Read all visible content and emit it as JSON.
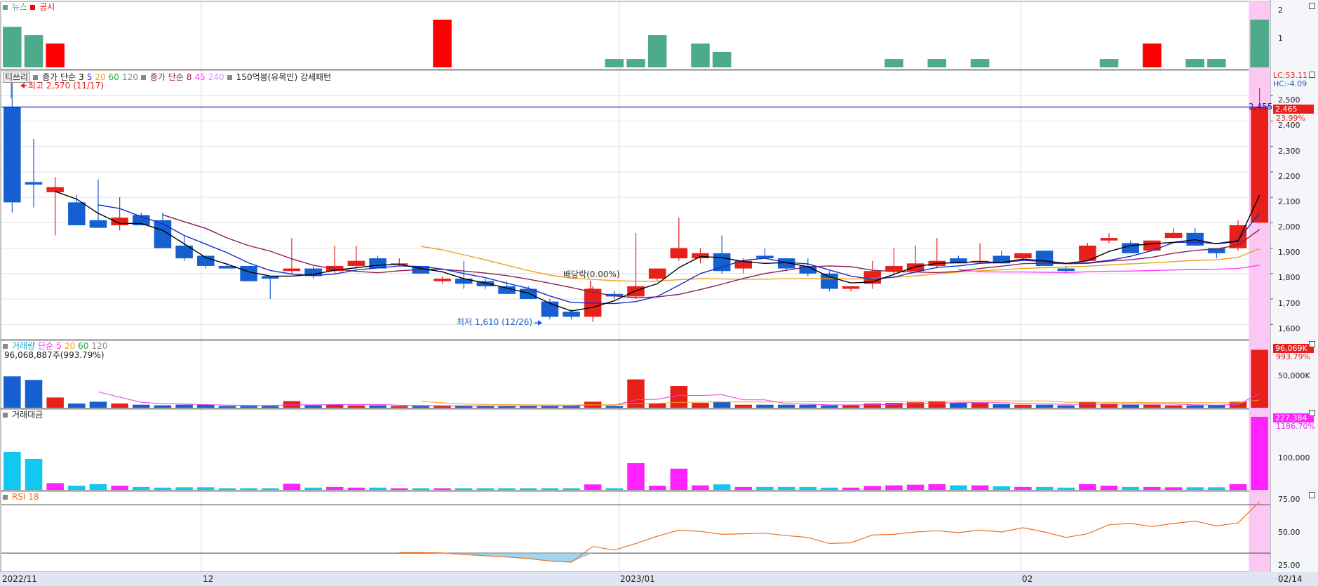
{
  "colors": {
    "up": "#e8201a",
    "down": "#1560d0",
    "news": "#4daa8a",
    "disclosure": "#ff0000",
    "amount": "#ff22ff",
    "amount_old": "#10c8f0",
    "highlight": "#fbc8f4",
    "ma3": "#000000",
    "ma5": "#1a2ccc",
    "ma8": "#8a1e50",
    "ma20": "#f0a020",
    "ma45": "#ff40ff",
    "rsi": "#f07020",
    "rsi_fill": "#9fd8ee",
    "hline": "#2020c0"
  },
  "news_panel": {
    "title_news": "뉴스",
    "title_disclosure": "공시",
    "ticks": [
      "2",
      "1"
    ]
  },
  "price_panel": {
    "name": "티쓰리",
    "ma_simple_label": "종가 단순",
    "ma_simple_periods": [
      "3",
      "5",
      "20",
      "60",
      "120"
    ],
    "ma_simple2_label": "종가 단순",
    "ma_simple2_periods": [
      "8",
      "45",
      "240"
    ],
    "pattern_label": "150억봉(유목민) 강세패턴",
    "high_note": "최고 2,570 (11/17)",
    "low_note": "최저 1,610 (12/26)",
    "dividend_note": "배당락(0.00%)",
    "hline_value": "2,455",
    "lc_label": "LC:53.11",
    "hc_label": "HC:-4.09",
    "last_price": "2,465",
    "last_change": "23.99%",
    "ticks": [
      "2,500",
      "2,400",
      "2,300",
      "2,200",
      "2,100",
      "2,000",
      "1,900",
      "1,800",
      "1,700",
      "1,600"
    ]
  },
  "volume_panel": {
    "title": "거래량",
    "ma_label": "단순",
    "periods": [
      "5",
      "20",
      "60",
      "120"
    ],
    "summary": "96,068,887주(993.79%)",
    "last_value": "96,069K",
    "last_pct": "993.79%",
    "tick": "50,000K"
  },
  "amount_panel": {
    "title": "거래대금",
    "last_value": "227,384",
    "last_pct": "1186.70%",
    "tick": "100,000"
  },
  "rsi_panel": {
    "title": "RSI 18",
    "ticks": [
      "75.00",
      "50.00",
      "25.00"
    ]
  },
  "xaxis": {
    "labels": [
      "2022/11",
      "12",
      "2023/01",
      "02"
    ],
    "right": "02/14"
  },
  "chart_data": {
    "type": "candlestick",
    "ohlc": [
      [
        2455,
        2570,
        2040,
        2080
      ],
      [
        2160,
        2330,
        2060,
        2150
      ],
      [
        2120,
        2180,
        1950,
        2140
      ],
      [
        2080,
        2110,
        1990,
        1990
      ],
      [
        2010,
        2170,
        1980,
        1980
      ],
      [
        1990,
        2100,
        1970,
        2020
      ],
      [
        2030,
        2040,
        1990,
        1990
      ],
      [
        2010,
        2040,
        1900,
        1900
      ],
      [
        1910,
        1950,
        1850,
        1860
      ],
      [
        1870,
        1870,
        1820,
        1830
      ],
      [
        1830,
        1840,
        1820,
        1820
      ],
      [
        1830,
        1830,
        1770,
        1770
      ],
      [
        1790,
        1790,
        1700,
        1780
      ],
      [
        1810,
        1940,
        1800,
        1820
      ],
      [
        1820,
        1830,
        1780,
        1790
      ],
      [
        1810,
        1910,
        1800,
        1830
      ],
      [
        1830,
        1910,
        1820,
        1850
      ],
      [
        1860,
        1870,
        1820,
        1820
      ],
      [
        1840,
        1860,
        1830,
        1840
      ],
      [
        1830,
        1830,
        1800,
        1800
      ],
      [
        1770,
        1790,
        1760,
        1780
      ],
      [
        1780,
        1850,
        1740,
        1760
      ],
      [
        1770,
        1780,
        1740,
        1750
      ],
      [
        1750,
        1770,
        1720,
        1720
      ],
      [
        1740,
        1750,
        1700,
        1700
      ],
      [
        1690,
        1700,
        1620,
        1630
      ],
      [
        1650,
        1660,
        1620,
        1630
      ],
      [
        1630,
        1750,
        1610,
        1740
      ],
      [
        1720,
        1730,
        1700,
        1710
      ],
      [
        1710,
        1960,
        1700,
        1750
      ],
      [
        1780,
        1820,
        1770,
        1820
      ],
      [
        1860,
        2020,
        1850,
        1900
      ],
      [
        1860,
        1900,
        1840,
        1880
      ],
      [
        1880,
        1950,
        1800,
        1810
      ],
      [
        1820,
        1860,
        1800,
        1850
      ],
      [
        1870,
        1900,
        1860,
        1860
      ],
      [
        1860,
        1860,
        1810,
        1820
      ],
      [
        1830,
        1860,
        1790,
        1800
      ],
      [
        1800,
        1810,
        1730,
        1740
      ],
      [
        1740,
        1750,
        1730,
        1750
      ],
      [
        1760,
        1850,
        1740,
        1810
      ],
      [
        1810,
        1900,
        1790,
        1830
      ],
      [
        1810,
        1910,
        1800,
        1840
      ],
      [
        1830,
        1940,
        1820,
        1850
      ],
      [
        1860,
        1870,
        1840,
        1840
      ],
      [
        1850,
        1920,
        1840,
        1850
      ],
      [
        1870,
        1890,
        1840,
        1840
      ],
      [
        1860,
        1880,
        1850,
        1880
      ],
      [
        1890,
        1890,
        1830,
        1830
      ],
      [
        1820,
        1830,
        1800,
        1810
      ],
      [
        1850,
        1920,
        1850,
        1910
      ],
      [
        1930,
        1960,
        1920,
        1940
      ],
      [
        1920,
        1930,
        1880,
        1880
      ],
      [
        1890,
        1930,
        1890,
        1930
      ],
      [
        1940,
        1980,
        1940,
        1960
      ],
      [
        1960,
        1980,
        1910,
        1910
      ],
      [
        1900,
        1900,
        1860,
        1880
      ],
      [
        1900,
        2010,
        1890,
        1990
      ],
      [
        2000,
        2530,
        2000,
        2455
      ]
    ],
    "ma3": [
      null,
      null,
      2123,
      2093,
      2037,
      1997,
      1997,
      1970,
      1917,
      1863,
      1837,
      1807,
      1790,
      1790,
      1797,
      1813,
      1823,
      1833,
      1837,
      1820,
      1807,
      1780,
      1763,
      1743,
      1723,
      1683,
      1653,
      1667,
      1693,
      1733,
      1760,
      1823,
      1867,
      1863,
      1847,
      1840,
      1843,
      1827,
      1787,
      1763,
      1767,
      1797,
      1827,
      1840,
      1843,
      1847,
      1843,
      1857,
      1850,
      1840,
      1850,
      1887,
      1910,
      1917,
      1923,
      1933,
      1917,
      1927,
      2108
    ],
    "ma5": [
      null,
      null,
      null,
      null,
      2070,
      2056,
      2024,
      1996,
      1950,
      1916,
      1882,
      1842,
      1812,
      1798,
      1792,
      1798,
      1814,
      1822,
      1830,
      1828,
      1818,
      1800,
      1784,
      1762,
      1742,
      1712,
      1686,
      1684,
      1682,
      1690,
      1710,
      1754,
      1800,
      1826,
      1852,
      1860,
      1844,
      1838,
      1814,
      1790,
      1778,
      1786,
      1806,
      1824,
      1830,
      1840,
      1844,
      1852,
      1848,
      1840,
      1842,
      1852,
      1868,
      1890,
      1922,
      1924,
      1918,
      1930,
      2040
    ],
    "ma8": [
      null,
      null,
      null,
      null,
      null,
      null,
      null,
      2031,
      2004,
      1978,
      1940,
      1910,
      1888,
      1858,
      1833,
      1818,
      1809,
      1803,
      1811,
      1816,
      1817,
      1810,
      1802,
      1792,
      1778,
      1762,
      1745,
      1727,
      1712,
      1705,
      1708,
      1718,
      1737,
      1758,
      1781,
      1800,
      1813,
      1826,
      1830,
      1827,
      1813,
      1808,
      1806,
      1804,
      1809,
      1820,
      1829,
      1839,
      1841,
      1839,
      1840,
      1849,
      1854,
      1864,
      1880,
      1891,
      1897,
      1912,
      1973
    ],
    "ma20": [
      null,
      null,
      null,
      null,
      null,
      null,
      null,
      null,
      null,
      null,
      null,
      null,
      null,
      null,
      null,
      null,
      null,
      null,
      null,
      1907,
      1893,
      1874,
      1854,
      1833,
      1812,
      1794,
      1782,
      1777,
      1772,
      1770,
      1770,
      1776,
      1780,
      1779,
      1777,
      1778,
      1780,
      1780,
      1780,
      1779,
      1781,
      1785,
      1791,
      1799,
      1806,
      1811,
      1815,
      1820,
      1823,
      1826,
      1829,
      1834,
      1838,
      1842,
      1847,
      1852,
      1854,
      1864,
      1898
    ],
    "ma45": [
      null,
      null,
      null,
      null,
      null,
      null,
      null,
      null,
      null,
      null,
      null,
      null,
      null,
      null,
      null,
      null,
      null,
      null,
      null,
      null,
      null,
      null,
      null,
      null,
      null,
      null,
      null,
      null,
      null,
      null,
      null,
      null,
      null,
      null,
      null,
      null,
      null,
      null,
      null,
      null,
      null,
      null,
      null,
      null,
      1816,
      1807,
      1806,
      1806,
      1805,
      1804,
      1807,
      1809,
      1810,
      1812,
      1814,
      1816,
      1817,
      1820,
      1833
    ],
    "volume": [
      52,
      46,
      17,
      7,
      10,
      7,
      5,
      4,
      5,
      5,
      3,
      3,
      3,
      11,
      4,
      5,
      4,
      4,
      3,
      3,
      3,
      3,
      3,
      3,
      3,
      3,
      3,
      10,
      3,
      47,
      7,
      36,
      8,
      10,
      5,
      5,
      5,
      5,
      4,
      4,
      7,
      8,
      9,
      10,
      8,
      8,
      6,
      5,
      5,
      4,
      10,
      7,
      5,
      5,
      4,
      4,
      4,
      10,
      96
    ],
    "volume_ma5": [
      null,
      null,
      null,
      null,
      26.4,
      17.4,
      9.2,
      6.6,
      6.2,
      5.2,
      4.4,
      4,
      3.8,
      5,
      4.8,
      5.2,
      5.4,
      5.6,
      4.2,
      3.8,
      3.4,
      3.2,
      3,
      3,
      3,
      3,
      3,
      4.4,
      4.4,
      13.2,
      14,
      20.6,
      20.2,
      21.6,
      13.2,
      13,
      6.6,
      6,
      4.8,
      4.6,
      5,
      5.6,
      6.4,
      7.6,
      8.4,
      8.6,
      8.2,
      7.4,
      6.4,
      5.6,
      6,
      6.2,
      6.2,
      6.2,
      6.2,
      5,
      4.4,
      5.4,
      23.6
    ],
    "volume_ma20": [
      null,
      null,
      null,
      null,
      null,
      null,
      null,
      null,
      null,
      null,
      null,
      null,
      null,
      null,
      null,
      null,
      null,
      null,
      null,
      10.6,
      8.2,
      6.1,
      5.4,
      5.2,
      4.8,
      4.6,
      4.5,
      4.9,
      4.8,
      7,
      7.2,
      8.9,
      9.2,
      9.5,
      9.6,
      9.6,
      9.6,
      9.9,
      9.9,
      9.9,
      10.1,
      10.3,
      10.6,
      10.9,
      11.2,
      11.4,
      11.5,
      11.2,
      11.3,
      9.2,
      9.4,
      8.9,
      8.8,
      8.5,
      8.5,
      8.4,
      8.3,
      8.3,
      12.9
    ],
    "amount": [
      118,
      96,
      21,
      13,
      18,
      13,
      9,
      7,
      8,
      8,
      5,
      5,
      5,
      19,
      7,
      9,
      7,
      7,
      5,
      5,
      5,
      5,
      5,
      5,
      5,
      5,
      5,
      17,
      5,
      83,
      13,
      66,
      14,
      17,
      9,
      9,
      9,
      9,
      7,
      7,
      12,
      14,
      16,
      18,
      14,
      14,
      11,
      9,
      9,
      7,
      18,
      13,
      9,
      9,
      8,
      8,
      8,
      18,
      227
    ],
    "rsi": [
      null,
      null,
      null,
      null,
      null,
      null,
      null,
      null,
      null,
      null,
      null,
      null,
      null,
      null,
      null,
      null,
      null,
      null,
      30.5,
      30.5,
      30.2,
      28.8,
      27.8,
      26.8,
      25.5,
      23.5,
      22.5,
      35.5,
      32.5,
      38,
      44,
      49,
      48,
      45.5,
      46,
      46.5,
      44.5,
      43,
      38,
      38.5,
      45,
      45.5,
      47.5,
      48.5,
      47,
      49,
      47.5,
      51,
      47.5,
      43,
      46,
      53.5,
      54.5,
      52,
      54.5,
      56.5,
      52.5,
      55,
      72.5
    ]
  }
}
